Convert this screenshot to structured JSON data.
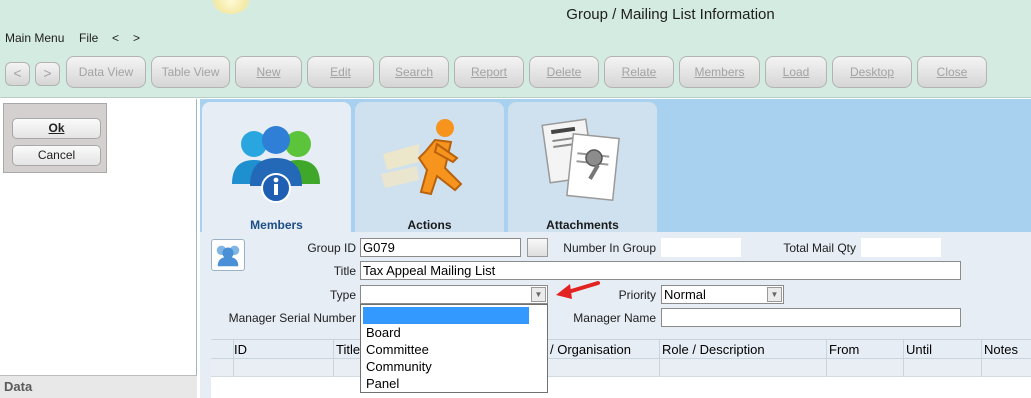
{
  "window": {
    "title": "Group / Mailing List Information"
  },
  "menu": {
    "items": [
      "Main Menu",
      "File",
      "<",
      ">"
    ]
  },
  "toolbar": {
    "back": "<",
    "forward": ">",
    "buttons": [
      "Data View",
      "Table View",
      "New",
      "Edit",
      "Search",
      "Report",
      "Delete",
      "Relate",
      "Members",
      "Load",
      "Desktop",
      "Close"
    ]
  },
  "panel": {
    "ok": "Ok",
    "cancel": "Cancel",
    "data_label": "Data"
  },
  "tabs": [
    {
      "label": "Members",
      "icon": "members-icon",
      "active": true
    },
    {
      "label": "Actions",
      "icon": "running-man-icon",
      "active": false
    },
    {
      "label": "Attachments",
      "icon": "documents-icon",
      "active": false
    }
  ],
  "form": {
    "group_id_label": "Group ID",
    "group_id": "G079",
    "number_in_group_label": "Number In Group",
    "number_in_group": "",
    "total_mail_qty_label": "Total Mail Qty",
    "total_mail_qty": "",
    "title_label": "Title",
    "title": "Tax Appeal Mailing List",
    "type_label": "Type",
    "type": "",
    "priority_label": "Priority",
    "priority": "Normal",
    "manager_serial_label": "Manager Serial Number",
    "manager_serial": "",
    "manager_name_label": "Manager Name",
    "manager_name": ""
  },
  "type_dropdown": {
    "options": [
      "",
      "Board",
      "Committee",
      "Community",
      "Panel"
    ]
  },
  "grid": {
    "columns": [
      "ID",
      "Title",
      "/ Organisation",
      "Role / Description",
      "From",
      "Until",
      "Notes"
    ]
  },
  "colors": {
    "chrome_bg": "#d4ebe1",
    "tab_strip": "#a8d1ef",
    "form_bg": "#e6edf4",
    "selection": "#3399ff",
    "annotation_arrow": "#e32222",
    "active_tab_text": "#1d4e86"
  }
}
